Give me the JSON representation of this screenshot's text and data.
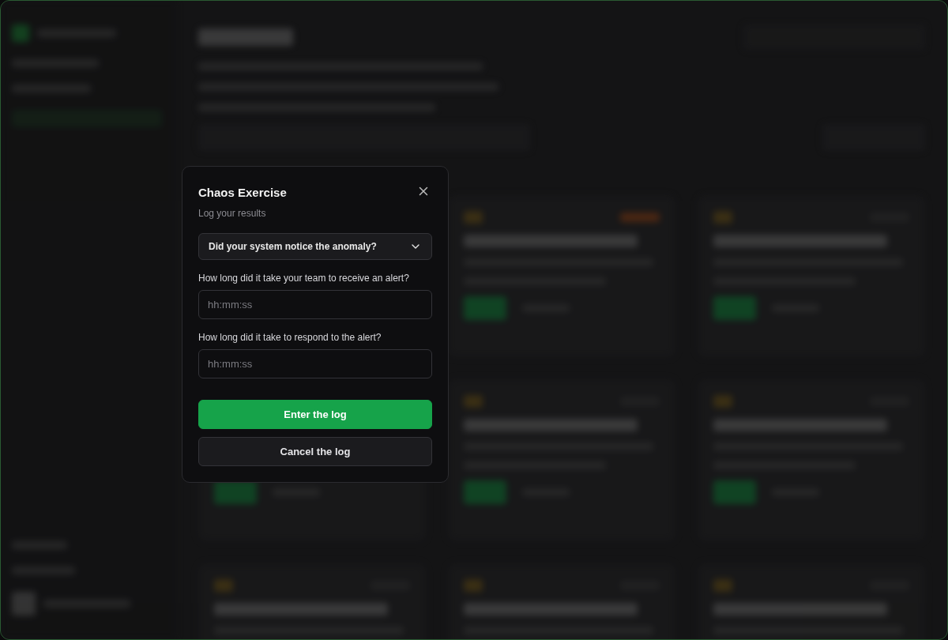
{
  "modal": {
    "title": "Chaos Exercise",
    "subtitle": "Log your results",
    "select": {
      "value": "Did your system notice the anomaly?"
    },
    "fields": [
      {
        "label": "How long did it take your team to receive an alert?",
        "placeholder": "hh:mm:ss"
      },
      {
        "label": "How long did it take to respond to the alert?",
        "placeholder": "hh:mm:ss"
      }
    ],
    "buttons": [
      {
        "label": "Enter the log",
        "kind": "primary"
      },
      {
        "label": "Cancel the log",
        "kind": "secondary"
      }
    ]
  }
}
